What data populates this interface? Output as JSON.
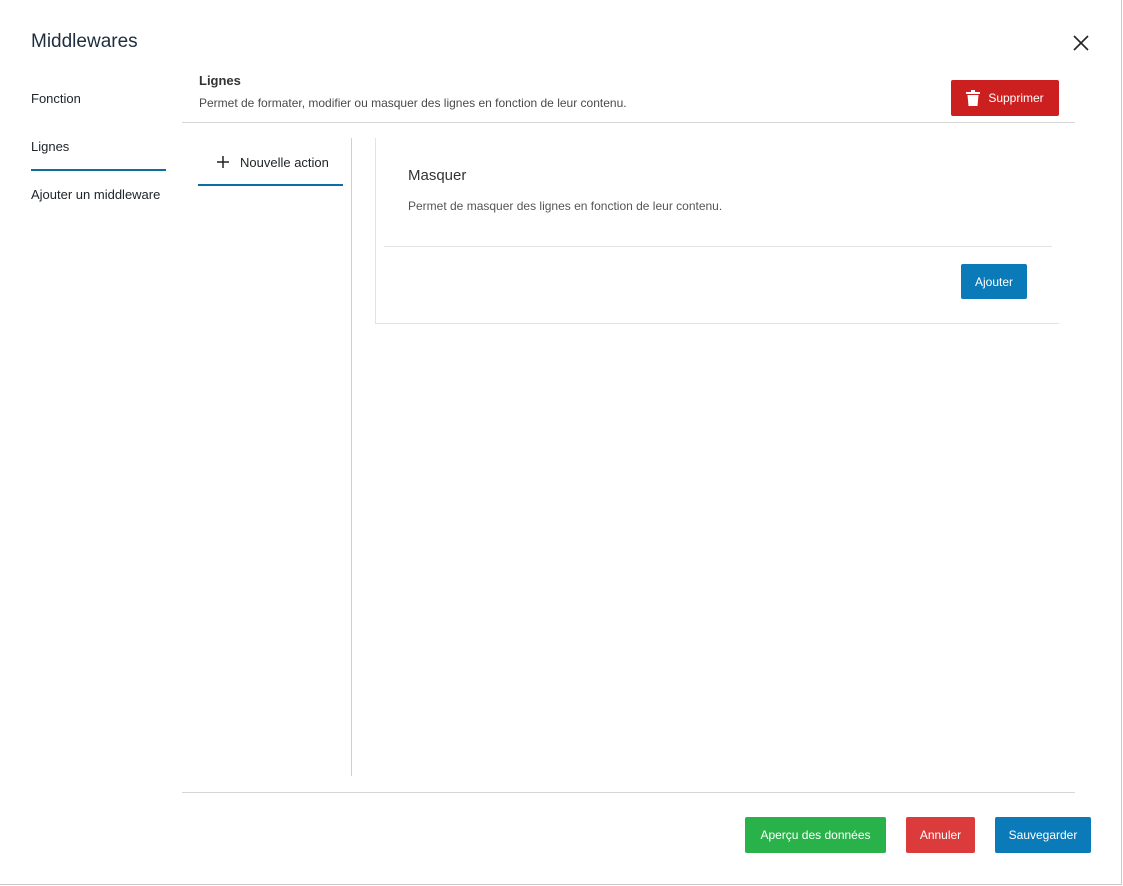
{
  "modal": {
    "title": "Middlewares",
    "close_icon": "close-icon"
  },
  "sidebar": {
    "items": [
      {
        "label": "Fonction",
        "active": false
      },
      {
        "label": "Lignes",
        "active": true
      },
      {
        "label": "Ajouter un middleware",
        "active": false
      }
    ]
  },
  "section": {
    "title": "Lignes",
    "description": "Permet de formater, modifier ou masquer des lignes en fonction de leur contenu.",
    "delete_label": "Supprimer",
    "delete_icon": "trash-icon"
  },
  "actions": {
    "new_action_label": "Nouvelle action",
    "new_action_icon": "plus-icon"
  },
  "card": {
    "title": "Masquer",
    "description": "Permet de masquer des lignes en fonction de leur contenu.",
    "add_label": "Ajouter"
  },
  "footer": {
    "preview_label": "Aperçu des données",
    "cancel_label": "Annuler",
    "save_label": "Sauvegarder"
  },
  "colors": {
    "accent": "#0f6f9c",
    "primary_button": "#0a7ab8",
    "danger": "#cc1f1f",
    "success": "#2ab24a",
    "cancel": "#dc3b3b"
  }
}
